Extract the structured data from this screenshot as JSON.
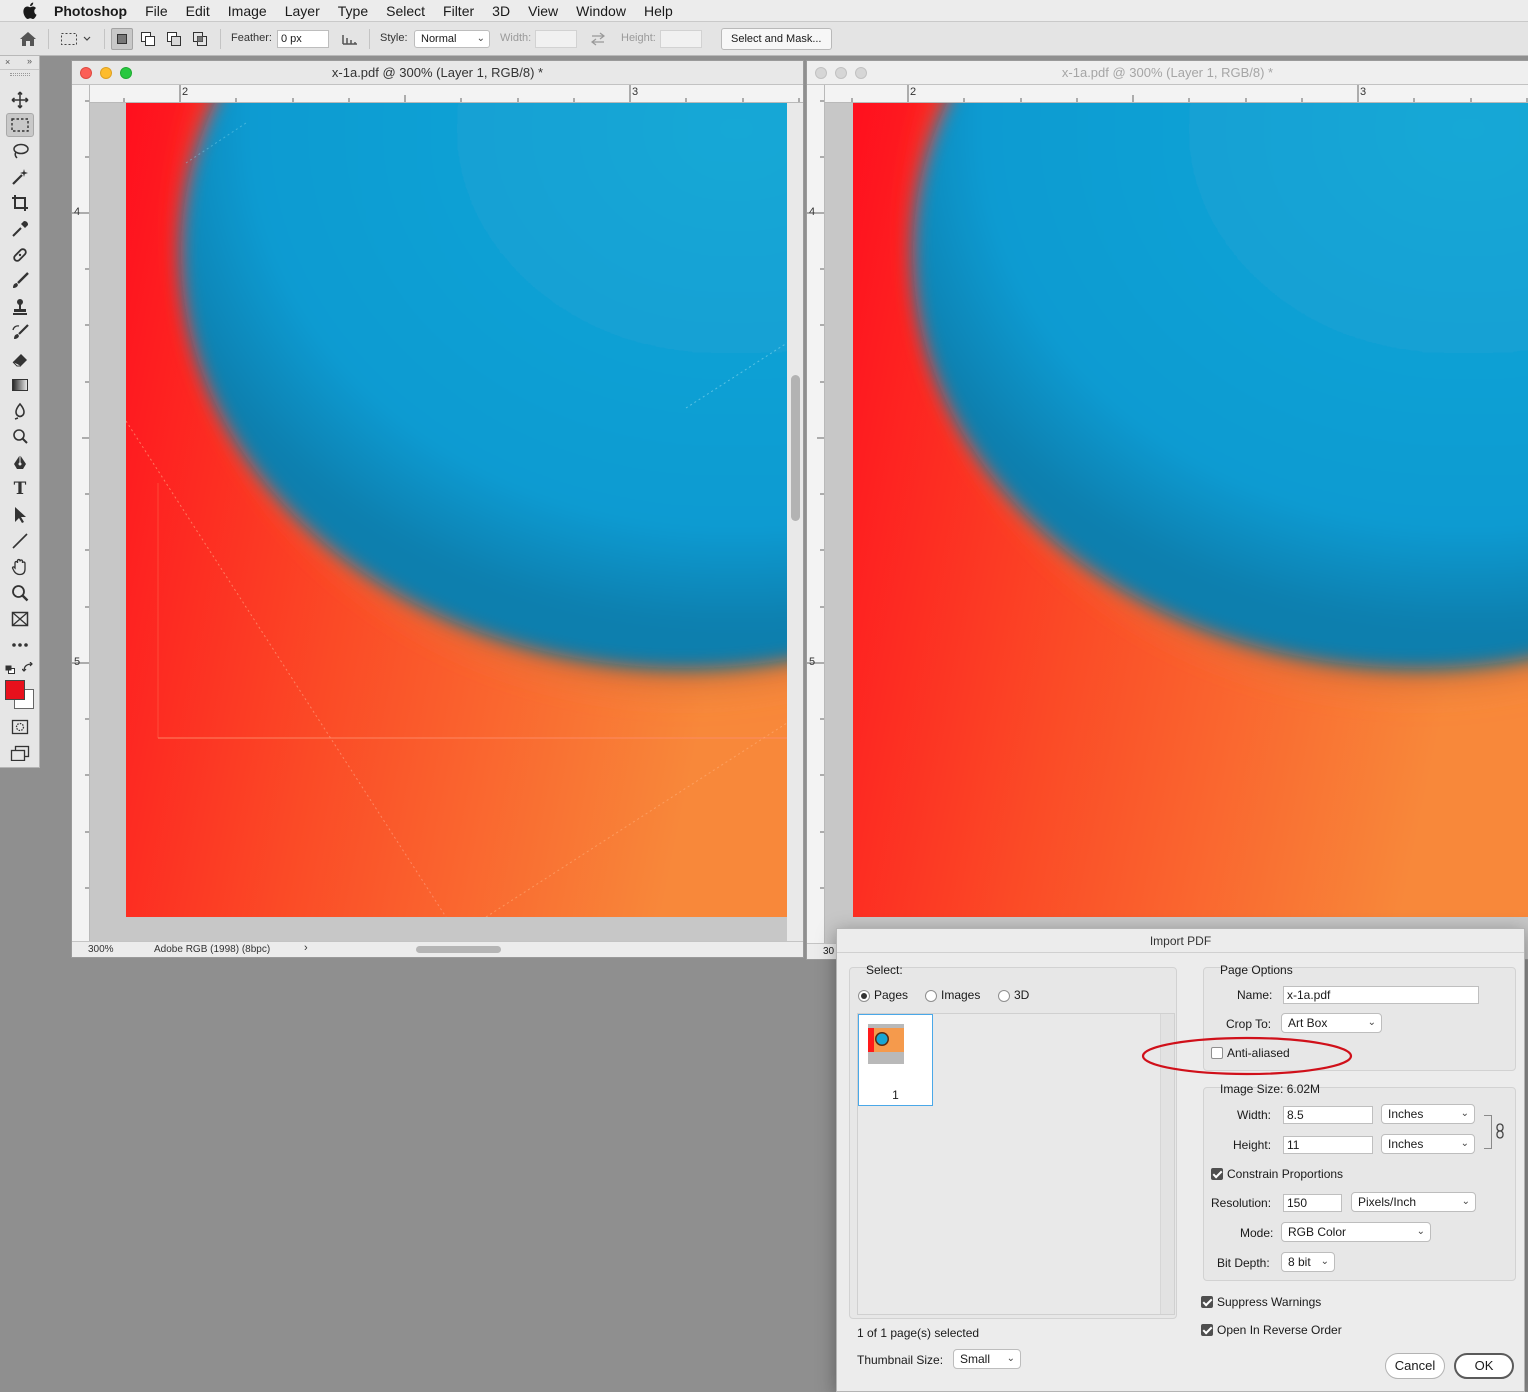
{
  "menubar": {
    "app_name": "Photoshop",
    "items": [
      "File",
      "Edit",
      "Image",
      "Layer",
      "Type",
      "Select",
      "Filter",
      "3D",
      "View",
      "Window",
      "Help"
    ]
  },
  "options_bar": {
    "feather_label": "Feather:",
    "feather_value": "0 px",
    "style_label": "Style:",
    "style_value": "Normal",
    "width_label": "Width:",
    "height_label": "Height:",
    "select_mask_button": "Select and Mask..."
  },
  "colors": {
    "foreground": "#e8101c",
    "background": "#ffffff",
    "annotation_ellipse": "#d0101a"
  },
  "tools": [
    "move-tool-icon",
    "rect-marquee-tool-icon",
    "lasso-tool-icon",
    "magic-wand-tool-icon",
    "crop-tool-icon",
    "eyedropper-tool-icon",
    "healing-brush-tool-icon",
    "brush-tool-icon",
    "clone-stamp-tool-icon",
    "history-brush-tool-icon",
    "eraser-tool-icon",
    "gradient-tool-icon",
    "blur-tool-icon",
    "dodge-tool-icon",
    "pen-tool-icon",
    "type-tool-icon",
    "path-selection-tool-icon",
    "line-tool-icon",
    "hand-tool-icon",
    "zoom-tool-icon",
    "frame-tool-icon",
    "more-tools-icon"
  ],
  "doc_left": {
    "title": "x-1a.pdf @ 300% (Layer 1, RGB/8) *",
    "ruler_h": [
      "2",
      "3"
    ],
    "ruler_v": [
      "4",
      "5"
    ],
    "zoom": "300%",
    "color_profile": "Adobe RGB (1998) (8bpc)"
  },
  "doc_right": {
    "title": "x-1a.pdf @ 300% (Layer 1, RGB/8) *",
    "ruler_h": [
      "2",
      "3"
    ],
    "ruler_v": [
      "4",
      "5"
    ],
    "zoom": "30"
  },
  "import_pdf": {
    "title": "Import PDF",
    "select_label": "Select:",
    "select_options": [
      "Pages",
      "Images",
      "3D"
    ],
    "select_value": "Pages",
    "thumbnail_page": "1",
    "selected_count": "1 of 1 page(s) selected",
    "thumbnail_size_label": "Thumbnail Size:",
    "thumbnail_size_value": "Small",
    "page_options_title": "Page Options",
    "name_label": "Name:",
    "name_value": "x-1a.pdf",
    "crop_label": "Crop To:",
    "crop_value": "Art Box",
    "anti_aliased_label": "Anti-aliased",
    "anti_aliased_checked": false,
    "image_size_title": "Image Size: 6.02M",
    "width_label": "Width:",
    "width_value": "8.5",
    "width_unit": "Inches",
    "height_label": "Height:",
    "height_value": "11",
    "height_unit": "Inches",
    "constrain_label": "Constrain Proportions",
    "constrain_checked": true,
    "resolution_label": "Resolution:",
    "resolution_value": "150",
    "resolution_unit": "Pixels/Inch",
    "mode_label": "Mode:",
    "mode_value": "RGB Color",
    "bit_depth_label": "Bit Depth:",
    "bit_depth_value": "8 bit",
    "suppress_label": "Suppress Warnings",
    "suppress_checked": true,
    "reverse_label": "Open In Reverse Order",
    "reverse_checked": true,
    "cancel_button": "Cancel",
    "ok_button": "OK"
  }
}
